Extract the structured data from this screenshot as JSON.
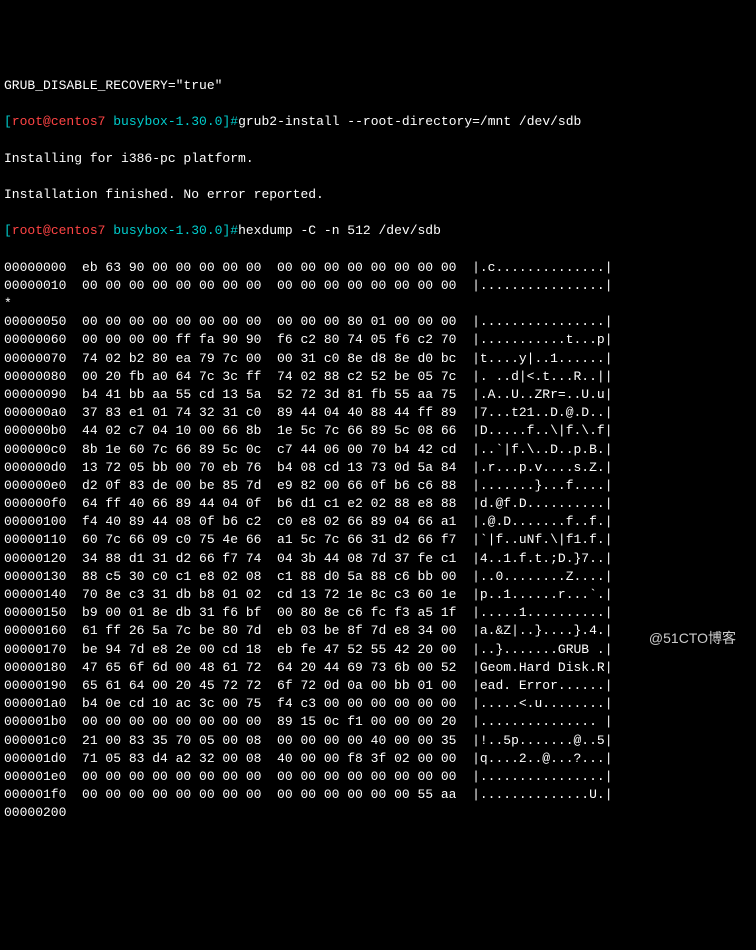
{
  "header_line": "GRUB_DISABLE_RECOVERY=\"true\"",
  "prompt1": {
    "bracket_open": "[",
    "user_host": "root@centos7",
    "path": " busybox-1.30.0",
    "bracket_close": "]#",
    "command": "grub2-install --root-directory=/mnt /dev/sdb"
  },
  "install_msg1": "Installing for i386-pc platform.",
  "install_msg2": "Installation finished. No error reported.",
  "prompt2": {
    "bracket_open": "[",
    "user_host": "root@centos7",
    "path": " busybox-1.30.0",
    "bracket_close": "]#",
    "command": "hexdump -C -n 512 /dev/sdb"
  },
  "hexdump": [
    "00000000  eb 63 90 00 00 00 00 00  00 00 00 00 00 00 00 00  |.c..............|",
    "00000010  00 00 00 00 00 00 00 00  00 00 00 00 00 00 00 00  |................|",
    "*",
    "00000050  00 00 00 00 00 00 00 00  00 00 00 80 01 00 00 00  |................|",
    "00000060  00 00 00 00 ff fa 90 90  f6 c2 80 74 05 f6 c2 70  |...........t...p|",
    "00000070  74 02 b2 80 ea 79 7c 00  00 31 c0 8e d8 8e d0 bc  |t....y|..1......|",
    "00000080  00 20 fb a0 64 7c 3c ff  74 02 88 c2 52 be 05 7c  |. ..d|<.t...R..||",
    "00000090  b4 41 bb aa 55 cd 13 5a  52 72 3d 81 fb 55 aa 75  |.A..U..ZRr=..U.u|",
    "000000a0  37 83 e1 01 74 32 31 c0  89 44 04 40 88 44 ff 89  |7...t21..D.@.D..|",
    "000000b0  44 02 c7 04 10 00 66 8b  1e 5c 7c 66 89 5c 08 66  |D.....f..\\|f.\\.f|",
    "000000c0  8b 1e 60 7c 66 89 5c 0c  c7 44 06 00 70 b4 42 cd  |..`|f.\\..D..p.B.|",
    "000000d0  13 72 05 bb 00 70 eb 76  b4 08 cd 13 73 0d 5a 84  |.r...p.v....s.Z.|",
    "000000e0  d2 0f 83 de 00 be 85 7d  e9 82 00 66 0f b6 c6 88  |.......}...f....|",
    "000000f0  64 ff 40 66 89 44 04 0f  b6 d1 c1 e2 02 88 e8 88  |d.@f.D..........|",
    "00000100  f4 40 89 44 08 0f b6 c2  c0 e8 02 66 89 04 66 a1  |.@.D.......f..f.|",
    "00000110  60 7c 66 09 c0 75 4e 66  a1 5c 7c 66 31 d2 66 f7  |`|f..uNf.\\|f1.f.|",
    "00000120  34 88 d1 31 d2 66 f7 74  04 3b 44 08 7d 37 fe c1  |4..1.f.t.;D.}7..|",
    "00000130  88 c5 30 c0 c1 e8 02 08  c1 88 d0 5a 88 c6 bb 00  |..0........Z....|",
    "00000140  70 8e c3 31 db b8 01 02  cd 13 72 1e 8c c3 60 1e  |p..1......r...`.|",
    "00000150  b9 00 01 8e db 31 f6 bf  00 80 8e c6 fc f3 a5 1f  |.....1..........|",
    "00000160  61 ff 26 5a 7c be 80 7d  eb 03 be 8f 7d e8 34 00  |a.&Z|..}....}.4.|",
    "00000170  be 94 7d e8 2e 00 cd 18  eb fe 47 52 55 42 20 00  |..}.......GRUB .|",
    "00000180  47 65 6f 6d 00 48 61 72  64 20 44 69 73 6b 00 52  |Geom.Hard Disk.R|",
    "00000190  65 61 64 00 20 45 72 72  6f 72 0d 0a 00 bb 01 00  |ead. Error......|",
    "000001a0  b4 0e cd 10 ac 3c 00 75  f4 c3 00 00 00 00 00 00  |.....<.u........|",
    "000001b0  00 00 00 00 00 00 00 00  89 15 0c f1 00 00 00 20  |............... |",
    "000001c0  21 00 83 35 70 05 00 08  00 00 00 00 40 00 00 35  |!..5p.......@..5|",
    "000001d0  71 05 83 d4 a2 32 00 08  40 00 00 f8 3f 02 00 00  |q....2..@...?...|",
    "000001e0  00 00 00 00 00 00 00 00  00 00 00 00 00 00 00 00  |................|",
    "000001f0  00 00 00 00 00 00 00 00  00 00 00 00 00 00 55 aa  |..............U.|",
    "00000200"
  ],
  "watermark": "@51CTO博客"
}
